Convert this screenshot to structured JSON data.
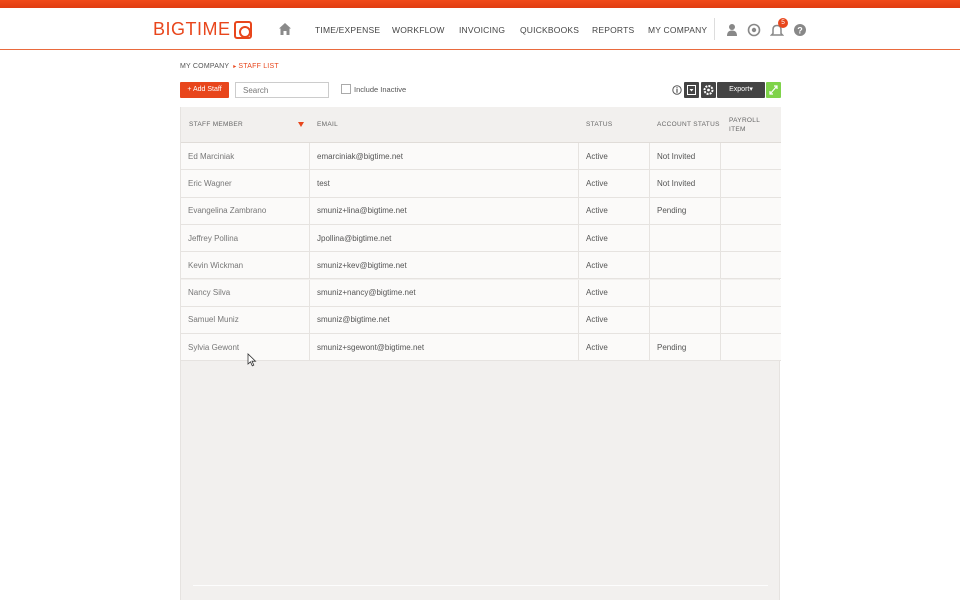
{
  "header": {
    "logo_text": "BIGTIME",
    "nav": [
      "TIME/EXPENSE",
      "WORKFLOW",
      "INVOICING",
      "QUICKBOOKS",
      "REPORTS",
      "MY COMPANY"
    ],
    "notification_count": "5",
    "icons": [
      "home-icon",
      "user-icon",
      "timer-icon",
      "bell-icon",
      "help-icon"
    ],
    "accent_color": "#e8461c"
  },
  "breadcrumb": {
    "parent": "MY COMPANY",
    "current": "STAFF LIST"
  },
  "toolbar": {
    "add_label": "+ Add Staff",
    "search_placeholder": "Search",
    "include_inactive_label": "Include Inactive",
    "include_inactive_checked": false,
    "export_label": "Export▾",
    "tool_icons": [
      "info-icon",
      "filter-icon",
      "gear-icon",
      "expand-icon"
    ]
  },
  "table": {
    "columns": [
      "STAFF MEMBER",
      "EMAIL",
      "STATUS",
      "ACCOUNT STATUS",
      "PAYROLL ITEM"
    ],
    "sorted_column": "STAFF MEMBER",
    "rows": [
      {
        "name": "Ed Marciniak",
        "email": "emarciniak@bigtime.net",
        "status": "Active",
        "account_status": "Not Invited",
        "payroll_item": ""
      },
      {
        "name": "Eric Wagner",
        "email": "test",
        "status": "Active",
        "account_status": "Not Invited",
        "payroll_item": ""
      },
      {
        "name": "Evangelina Zambrano",
        "email": "smuniz+lina@bigtime.net",
        "status": "Active",
        "account_status": "Pending",
        "payroll_item": ""
      },
      {
        "name": "Jeffrey Pollina",
        "email": "Jpollina@bigtime.net",
        "status": "Active",
        "account_status": "",
        "payroll_item": ""
      },
      {
        "name": "Kevin Wickman",
        "email": "smuniz+kev@bigtime.net",
        "status": "Active",
        "account_status": "",
        "payroll_item": ""
      },
      {
        "name": "Nancy Silva",
        "email": "smuniz+nancy@bigtime.net",
        "status": "Active",
        "account_status": "",
        "payroll_item": ""
      },
      {
        "name": "Samuel Muniz",
        "email": "smuniz@bigtime.net",
        "status": "Active",
        "account_status": "",
        "payroll_item": ""
      },
      {
        "name": "Sylvia Gewont",
        "email": "smuniz+sgewont@bigtime.net",
        "status": "Active",
        "account_status": "Pending",
        "payroll_item": ""
      }
    ]
  }
}
